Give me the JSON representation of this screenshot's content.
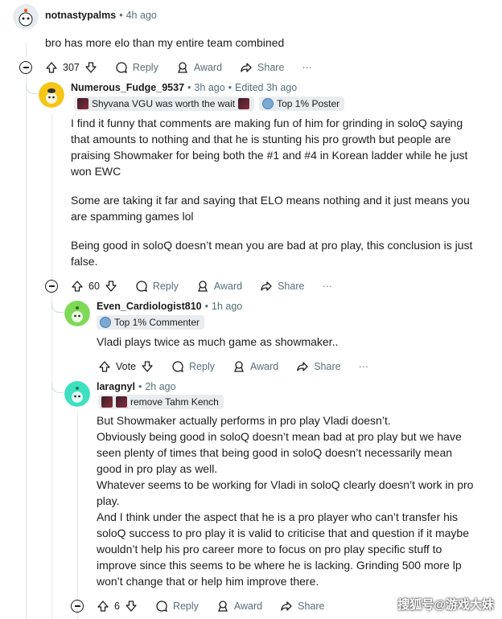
{
  "comments": [
    {
      "author": "notnastypalms",
      "time": "4h ago",
      "body": [
        "bro has more elo than my entire team combined"
      ],
      "score": "307",
      "reply": "Reply",
      "award": "Award",
      "share": "Share",
      "more": "···"
    },
    {
      "author": "Numerous_Fudge_9537",
      "time": "3h ago",
      "edited": "Edited 3h ago",
      "flair": "Shyvana VGU was worth the wait",
      "badge": "Top 1% Poster",
      "body": [
        "I find it funny that comments are making fun of him for grinding in soloQ saying that amounts to nothing and that he is stunting his pro growth but people are praising Showmaker for being both the #1 and #4 in Korean ladder while he just won EWC",
        "Some are taking it far and saying that ELO means nothing and it just means you are spamming games lol",
        "Being good in soloQ doesn’t mean you are bad at pro play, this conclusion is just false."
      ],
      "score": "60",
      "reply": "Reply",
      "award": "Award",
      "share": "Share",
      "more": "···"
    },
    {
      "author": "Even_Cardiologist810",
      "time": "1h ago",
      "badge": "Top 1% Commenter",
      "body": [
        "Vladi plays twice as much game as showmaker.."
      ],
      "score": "Vote",
      "reply": "Reply",
      "award": "Award",
      "share": "Share",
      "more": "···"
    },
    {
      "author": "laragnyl",
      "time": "2h ago",
      "flair": "remove Tahm Kench",
      "body": [
        "But Showmaker actually performs in pro play Vladi doesn’t.",
        "Obviously being good in soloQ doesn’t mean bad at pro play but we have seen plenty of times that being good in soloQ doesn’t necessarily mean good in pro play as well.",
        "Whatever seems to be working for Vladi in soloQ clearly doesn’t work in pro play.",
        "And I think under the aspect that he is a pro player who can’t transfer his soloQ success to pro play it is valid to criticise that and question if it maybe wouldn’t help his pro career more to focus on pro play specific stuff to improve since this seems to be where he is lacking. Grinding 500 more lp won’t change that or help him improve there."
      ],
      "score": "6",
      "reply": "Reply",
      "award": "Award",
      "share": "Share"
    }
  ],
  "watermark": "搜狐号@游戏大妹",
  "colors": {
    "avatar1": "#e6ecef",
    "avatar2": "#f5c518",
    "avatar3": "#7ed957",
    "avatar4": "#3ee0c0"
  }
}
